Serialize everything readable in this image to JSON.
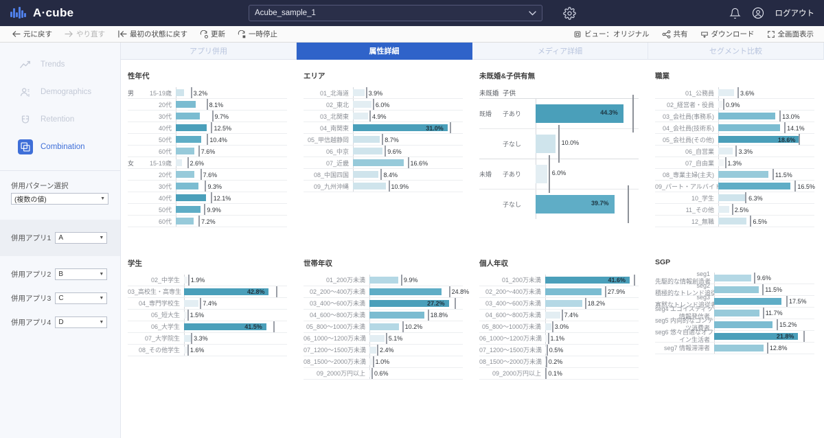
{
  "app": {
    "brand": "A·cube",
    "file_name": "Acube_sample_1",
    "logout": "ログアウト",
    "accent": "#2f63c9",
    "topbar_bg": "#252a43"
  },
  "toolbar": {
    "undo": "元に戻す",
    "redo": "やり直す",
    "reset": "最初の状態に戻す",
    "refresh": "更新",
    "pause": "一時停止",
    "view": "ビュー：オリジナル",
    "share": "共有",
    "download": "ダウンロード",
    "fullscreen": "全画面表示"
  },
  "sidebar": {
    "nav": [
      {
        "label": "Trends",
        "icon": "trend-icon",
        "active": false
      },
      {
        "label": "Demographics",
        "icon": "people-icon",
        "active": false
      },
      {
        "label": "Retention",
        "icon": "magnet-icon",
        "active": false
      },
      {
        "label": "Combination",
        "icon": "combination-icon",
        "active": true
      }
    ],
    "pattern_label": "併用パターン選択",
    "pattern_value": "(複数の値)",
    "apps": [
      {
        "label": "併用アプリ1",
        "value": "A"
      },
      {
        "label": "併用アプリ2",
        "value": "B"
      },
      {
        "label": "併用アプリ3",
        "value": "C"
      },
      {
        "label": "併用アプリ4",
        "value": "D"
      }
    ]
  },
  "tabs": [
    {
      "label": "アプリ併用",
      "active": false
    },
    {
      "label": "属性詳細",
      "active": true
    },
    {
      "label": "メディア詳細",
      "active": false
    },
    {
      "label": "セグメント比較",
      "active": false
    }
  ],
  "chart_data": [
    {
      "id": "gender-age",
      "type": "bar",
      "title": "性年代",
      "orientation": "horizontal",
      "xlabel": "",
      "ylabel": "",
      "xlim": [
        0,
        45
      ],
      "grid": true,
      "groups": [
        {
          "name": "男",
          "categories": [
            "15-19歳",
            "20代",
            "30代",
            "40代",
            "50代",
            "60代"
          ],
          "values": [
            3.2,
            8.1,
            9.7,
            12.5,
            10.4,
            7.6
          ],
          "markers": [
            6.0,
            12.4,
            14.6,
            14.3,
            12.6,
            9.1
          ]
        },
        {
          "name": "女",
          "categories": [
            "15-19歳",
            "20代",
            "30代",
            "40代",
            "50代",
            "60代"
          ],
          "values": [
            2.6,
            7.6,
            9.3,
            12.1,
            9.9,
            7.2
          ],
          "markers": [
            4.6,
            9.9,
            11.8,
            14.1,
            11.5,
            9.2
          ]
        }
      ]
    },
    {
      "id": "area",
      "type": "bar",
      "title": "エリア",
      "orientation": "horizontal",
      "xlim": [
        0,
        36
      ],
      "categories": [
        "01_北海道",
        "02_東北",
        "03_北関東",
        "04_南関東",
        "05_甲信越静岡",
        "06_中京",
        "07_近畿",
        "08_中国四国",
        "09_九州沖縄"
      ],
      "values": [
        3.9,
        6.0,
        4.9,
        31.0,
        8.7,
        9.6,
        16.6,
        8.4,
        10.9
      ],
      "markers": [
        4.2,
        6.5,
        5.4,
        31.8,
        9.5,
        10.4,
        17.9,
        9.1,
        11.6
      ]
    },
    {
      "id": "marital-children",
      "type": "bar",
      "title": "未既婚&子供有無",
      "orientation": "horizontal",
      "header": [
        "未既婚",
        "子供"
      ],
      "xlim": [
        0,
        52
      ],
      "rows": [
        {
          "group": "既婚",
          "sub": "子あり",
          "value": 44.3,
          "marker": 49.0,
          "label_inside": true
        },
        {
          "group": "",
          "sub": "子なし",
          "value": 10.0,
          "marker": 11.3,
          "label_inside": false
        },
        {
          "group": "未婚",
          "sub": "子あり",
          "value": 6.0,
          "marker": 6.5,
          "label_inside": false
        },
        {
          "group": "",
          "sub": "子なし",
          "value": 39.7,
          "marker": 46.5,
          "label_inside": true
        }
      ]
    },
    {
      "id": "occupation",
      "type": "bar",
      "title": "職業",
      "orientation": "horizontal",
      "xlim": [
        0,
        22
      ],
      "categories": [
        "01_公務員",
        "02_経営者・役員",
        "03_会社員(事務系)",
        "04_会社員(技術系)",
        "05_会社員(その他)",
        "06_自営業",
        "07_自由業",
        "08_専業主婦(主夫)",
        "09_パート・アルバイト",
        "10_学生",
        "11_その他",
        "12_無職"
      ],
      "values": [
        3.6,
        0.9,
        13.0,
        14.1,
        18.6,
        3.3,
        1.3,
        11.5,
        16.5,
        6.3,
        2.5,
        6.5
      ],
      "markers": [
        4.4,
        1.1,
        14.0,
        15.1,
        18.4,
        4.0,
        1.5,
        12.4,
        17.5,
        6.1,
        3.1,
        7.3
      ]
    },
    {
      "id": "student",
      "type": "bar",
      "title": "学生",
      "orientation": "horizontal",
      "xlim": [
        0,
        52
      ],
      "categories": [
        "02_中学生",
        "03_高校生・高専生",
        "04_専門学校生",
        "05_短大生",
        "06_大学生",
        "07_大学院生",
        "08_その他学生"
      ],
      "values": [
        1.9,
        42.8,
        7.4,
        1.5,
        41.5,
        3.3,
        1.6
      ],
      "markers": [
        2.0,
        46.4,
        8.1,
        1.6,
        45.2,
        3.5,
        1.7
      ]
    },
    {
      "id": "household-income",
      "type": "bar",
      "title": "世帯年収",
      "orientation": "horizontal",
      "xlim": [
        0,
        32
      ],
      "categories": [
        "01_200万未満",
        "02_200〜400万未満",
        "03_400〜600万未満",
        "04_600〜800万未満",
        "05_800〜1000万未満",
        "06_1000〜1200万未満",
        "07_1200〜1500万未満",
        "08_1500〜2000万未満",
        "09_2000万円以上"
      ],
      "values": [
        9.9,
        24.8,
        27.2,
        18.8,
        10.2,
        5.1,
        2.4,
        1.0,
        0.6
      ],
      "markers": [
        10.8,
        27.2,
        29.1,
        19.9,
        11.2,
        5.6,
        2.6,
        1.1,
        0.7
      ]
    },
    {
      "id": "personal-income",
      "type": "bar",
      "title": "個人年収",
      "orientation": "horizontal",
      "xlim": [
        0,
        46
      ],
      "categories": [
        "01_200万未満",
        "02_200〜400万未満",
        "03_400〜600万未満",
        "04_600〜800万未満",
        "05_800〜1000万未満",
        "06_1000〜1200万未満",
        "07_1200〜1500万未満",
        "08_1500〜2000万未満",
        "09_2000万円以上"
      ],
      "values": [
        41.6,
        27.9,
        18.2,
        7.4,
        3.0,
        1.1,
        0.5,
        0.2,
        0.1
      ],
      "markers": [
        43.8,
        29.4,
        19.5,
        8.0,
        3.3,
        1.2,
        0.6,
        0.25,
        0.12
      ]
    },
    {
      "id": "sgp",
      "type": "bar",
      "title": "SGP",
      "orientation": "horizontal",
      "xlim": [
        0,
        26
      ],
      "categories": [
        "seg1\n先駆的な情報創造者",
        "seg2\n積極的なトレンド追従者",
        "seg3\n寡黙なトレンド追従者",
        "seg4 エゴイスティック\n情報発信者",
        "seg5 内向的なコンテン\nツ消費者",
        "seg6 悠々自適なオフラ\nイン生活者",
        "seg7 情報滞滞者"
      ],
      "values": [
        9.6,
        11.5,
        17.5,
        11.7,
        15.2,
        21.8,
        12.8
      ],
      "markers": [
        10.4,
        12.5,
        18.7,
        12.6,
        16.2,
        23.2,
        13.7
      ]
    }
  ]
}
